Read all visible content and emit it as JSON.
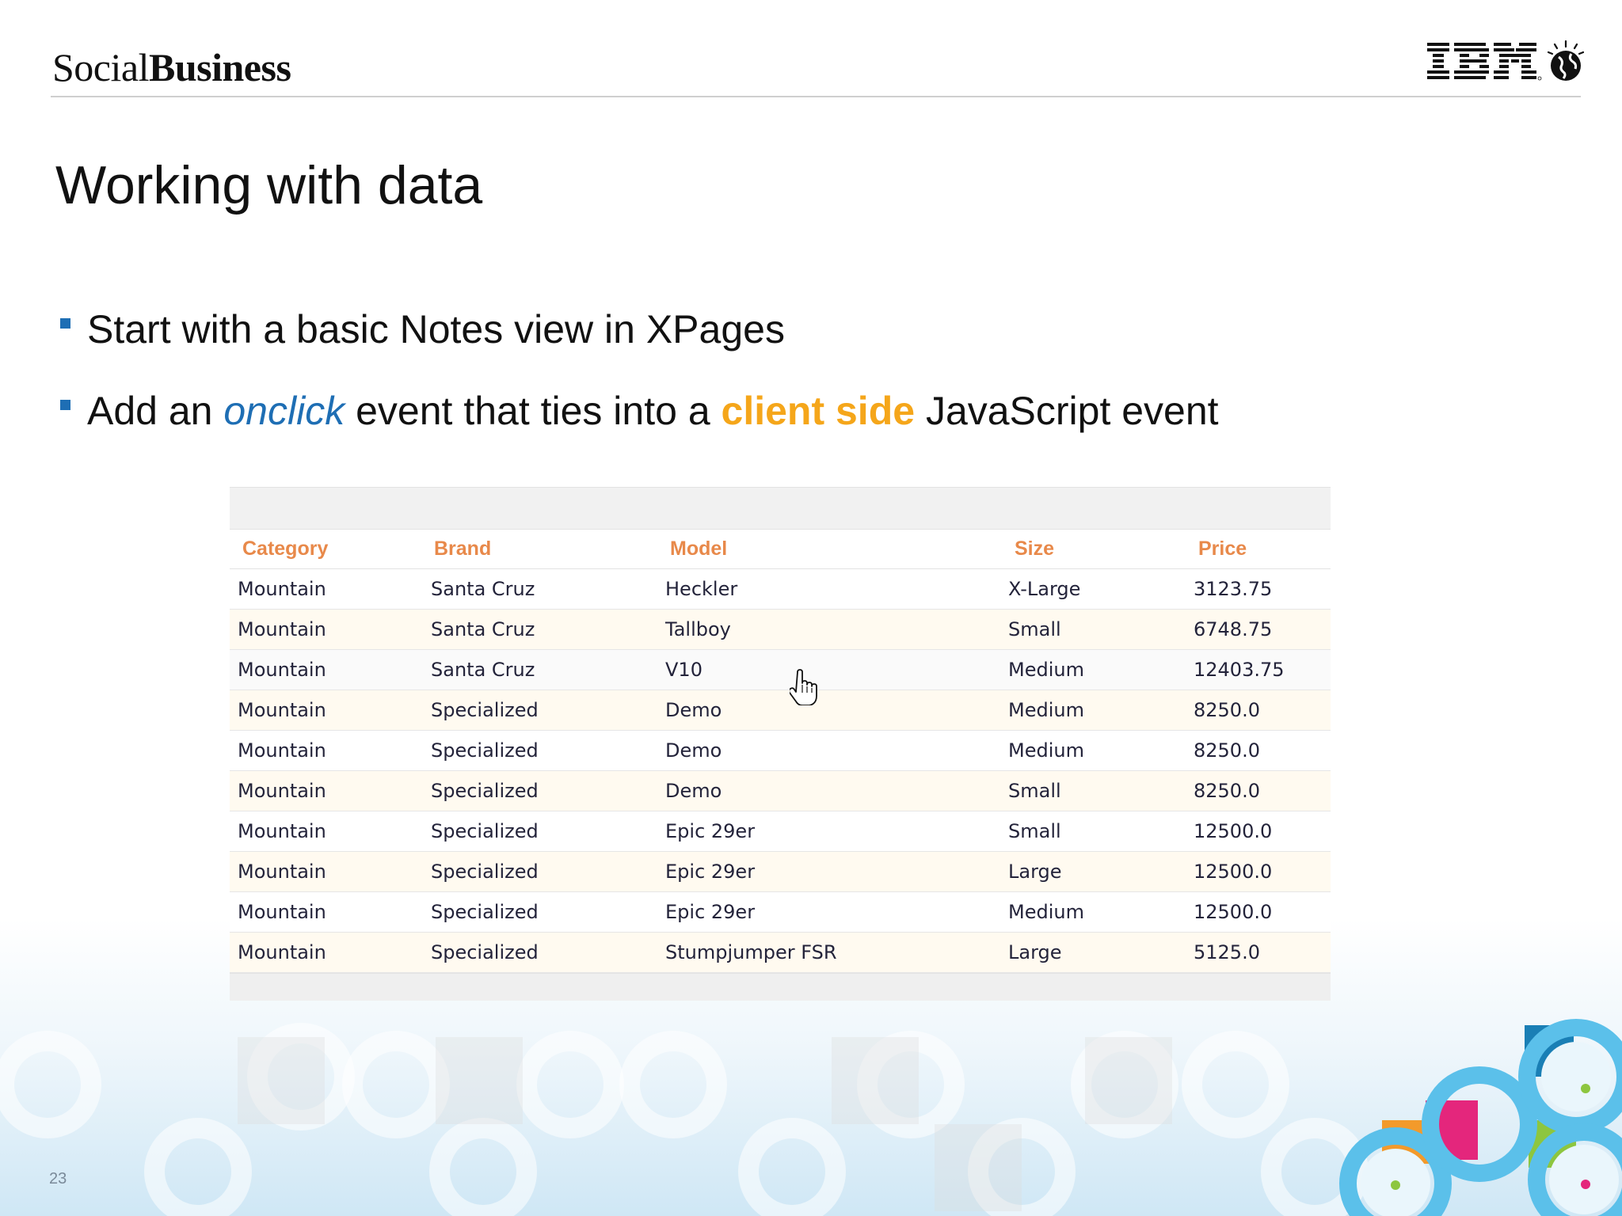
{
  "header": {
    "brand_light": "Social",
    "brand_bold": "Business",
    "logo_label": "IBM"
  },
  "title": "Working with data",
  "bullets": [
    {
      "plain": "Start with a basic Notes view in XPages"
    },
    {
      "part1": "Add an ",
      "onclick": "onclick",
      "part2": " event that ties into a ",
      "client_side": "client side",
      "part3": " JavaScript event"
    }
  ],
  "table": {
    "columns": [
      "Category",
      "Brand",
      "Model",
      "Size",
      "Price"
    ],
    "rows": [
      [
        "Mountain",
        "Santa Cruz",
        "Heckler",
        "X-Large",
        "3123.75"
      ],
      [
        "Mountain",
        "Santa Cruz",
        "Tallboy",
        "Small",
        "6748.75"
      ],
      [
        "Mountain",
        "Santa Cruz",
        "V10",
        "Medium",
        "12403.75"
      ],
      [
        "Mountain",
        "Specialized",
        "Demo",
        "Medium",
        "8250.0"
      ],
      [
        "Mountain",
        "Specialized",
        "Demo",
        "Medium",
        "8250.0"
      ],
      [
        "Mountain",
        "Specialized",
        "Demo",
        "Small",
        "8250.0"
      ],
      [
        "Mountain",
        "Specialized",
        "Epic 29er",
        "Small",
        "12500.0"
      ],
      [
        "Mountain",
        "Specialized",
        "Epic 29er",
        "Large",
        "12500.0"
      ],
      [
        "Mountain",
        "Specialized",
        "Epic 29er",
        "Medium",
        "12500.0"
      ],
      [
        "Mountain",
        "Specialized",
        "Stumpjumper FSR",
        "Large",
        "5125.0"
      ]
    ]
  },
  "page_number": "23",
  "colors": {
    "accent_blue": "#1e6eb4",
    "accent_orange": "#f5a61a",
    "header_orange": "#e8894a"
  }
}
